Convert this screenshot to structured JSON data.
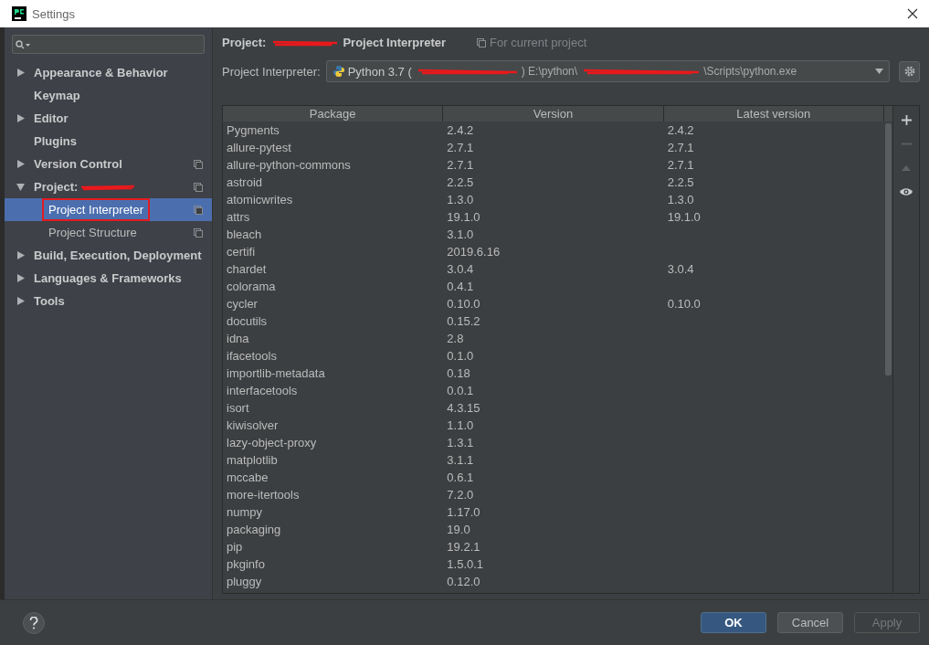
{
  "window": {
    "title": "Settings"
  },
  "sidebar": {
    "items": [
      {
        "label": "Appearance & Behavior",
        "kind": "group",
        "expanded": false,
        "project_scoped": false,
        "selected": false
      },
      {
        "label": "Keymap",
        "kind": "page",
        "project_scoped": false,
        "selected": false
      },
      {
        "label": "Editor",
        "kind": "group",
        "expanded": false,
        "project_scoped": false,
        "selected": false
      },
      {
        "label": "Plugins",
        "kind": "page",
        "project_scoped": false,
        "selected": false
      },
      {
        "label": "Version Control",
        "kind": "group",
        "expanded": false,
        "project_scoped": true,
        "selected": false
      },
      {
        "label": "Project:",
        "kind": "group",
        "expanded": true,
        "project_scoped": true,
        "selected": false,
        "redacted": true,
        "children": [
          {
            "label": "Project Interpreter",
            "project_scoped": true,
            "selected": true,
            "highlighted": true
          },
          {
            "label": "Project Structure",
            "project_scoped": true,
            "selected": false,
            "highlighted": false
          }
        ]
      },
      {
        "label": "Build, Execution, Deployment",
        "kind": "group",
        "expanded": false,
        "project_scoped": false,
        "selected": false
      },
      {
        "label": "Languages & Frameworks",
        "kind": "group",
        "expanded": false,
        "project_scoped": false,
        "selected": false
      },
      {
        "label": "Tools",
        "kind": "group",
        "expanded": false,
        "project_scoped": false,
        "selected": false
      }
    ]
  },
  "breadcrumb": {
    "project": "Project:",
    "page": "Project Interpreter",
    "note": "For current project"
  },
  "interpreter": {
    "label": "Project Interpreter:",
    "name": "Python 3.7 (",
    "path_start": ") E:\\python\\",
    "path_end": "\\Scripts\\python.exe"
  },
  "table": {
    "columns": [
      "Package",
      "Version",
      "Latest version"
    ],
    "rows": [
      [
        "Pygments",
        "2.4.2",
        "2.4.2"
      ],
      [
        "allure-pytest",
        "2.7.1",
        "2.7.1"
      ],
      [
        "allure-python-commons",
        "2.7.1",
        "2.7.1"
      ],
      [
        "astroid",
        "2.2.5",
        "2.2.5"
      ],
      [
        "atomicwrites",
        "1.3.0",
        "1.3.0"
      ],
      [
        "attrs",
        "19.1.0",
        "19.1.0"
      ],
      [
        "bleach",
        "3.1.0",
        ""
      ],
      [
        "certifi",
        "2019.6.16",
        ""
      ],
      [
        "chardet",
        "3.0.4",
        "3.0.4"
      ],
      [
        "colorama",
        "0.4.1",
        ""
      ],
      [
        "cycler",
        "0.10.0",
        "0.10.0"
      ],
      [
        "docutils",
        "0.15.2",
        ""
      ],
      [
        "idna",
        "2.8",
        ""
      ],
      [
        "ifacetools",
        "0.1.0",
        ""
      ],
      [
        "importlib-metadata",
        "0.18",
        ""
      ],
      [
        "interfacetools",
        "0.0.1",
        ""
      ],
      [
        "isort",
        "4.3.15",
        ""
      ],
      [
        "kiwisolver",
        "1.1.0",
        ""
      ],
      [
        "lazy-object-proxy",
        "1.3.1",
        ""
      ],
      [
        "matplotlib",
        "3.1.1",
        ""
      ],
      [
        "mccabe",
        "0.6.1",
        ""
      ],
      [
        "more-itertools",
        "7.2.0",
        ""
      ],
      [
        "numpy",
        "1.17.0",
        ""
      ],
      [
        "packaging",
        "19.0",
        ""
      ],
      [
        "pip",
        "19.2.1",
        ""
      ],
      [
        "pkginfo",
        "1.5.0.1",
        ""
      ],
      [
        "pluggy",
        "0.12.0",
        ""
      ]
    ]
  },
  "table_tools": [
    {
      "kind": "add",
      "disabled": false
    },
    {
      "kind": "remove",
      "disabled": true
    },
    {
      "kind": "up",
      "disabled": true
    },
    {
      "kind": "show",
      "disabled": false
    }
  ],
  "buttons": [
    {
      "label": "OK",
      "kind": "primary",
      "disabled": false
    },
    {
      "label": "Cancel",
      "kind": "normal",
      "disabled": false
    },
    {
      "label": "Apply",
      "kind": "normal",
      "disabled": true
    }
  ]
}
